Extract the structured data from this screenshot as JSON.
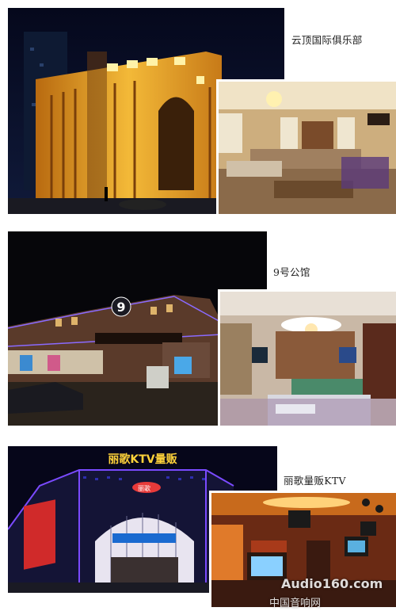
{
  "sections": [
    {
      "caption": "云顶国际俱乐部"
    },
    {
      "caption": "9号公馆",
      "sign_number": "9"
    },
    {
      "caption": "丽歌量贩KTV",
      "sign_text": "丽歌KTV量贩",
      "bowl_logo": "丽歌"
    }
  ],
  "watermark": {
    "text": "Audio160.com",
    "subtext": "中国音响网"
  }
}
